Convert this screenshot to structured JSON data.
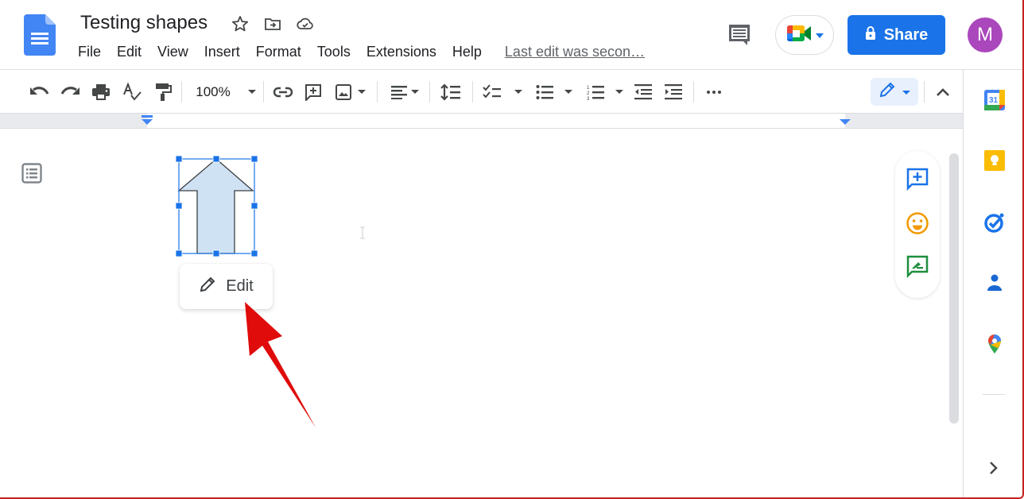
{
  "app": {
    "name": "Google Docs",
    "document_title": "Testing shapes"
  },
  "header": {
    "title_icons": [
      "star-icon",
      "move-to-folder-icon",
      "cloud-saved-icon"
    ],
    "menu": [
      "File",
      "Edit",
      "View",
      "Insert",
      "Format",
      "Tools",
      "Extensions",
      "Help"
    ],
    "last_edit": "Last edit was secon…",
    "share_label": "Share",
    "avatar_initial": "M",
    "colors": {
      "share": "#1a73e8",
      "avatar": "#ab47bc"
    }
  },
  "toolbar": {
    "zoom": "100%",
    "buttons": [
      "undo",
      "redo",
      "print",
      "spellcheck",
      "paint-format",
      "zoom",
      "insert-link",
      "add-comment",
      "insert-image",
      "align",
      "line-spacing",
      "checklist",
      "bulleted-list",
      "numbered-list",
      "decrease-indent",
      "increase-indent",
      "more",
      "editing-mode",
      "hide-menus"
    ]
  },
  "document": {
    "selected_shape": "up-arrow",
    "shape_fill": "#cfe2f3",
    "edit_popup_label": "Edit",
    "annotation_color": "#e00b0b"
  },
  "floating_actions": [
    "add-comment",
    "add-emoji-reaction",
    "suggest-edits"
  ],
  "side_panel": [
    "Calendar",
    "Keep",
    "Tasks",
    "Contacts",
    "Maps"
  ]
}
